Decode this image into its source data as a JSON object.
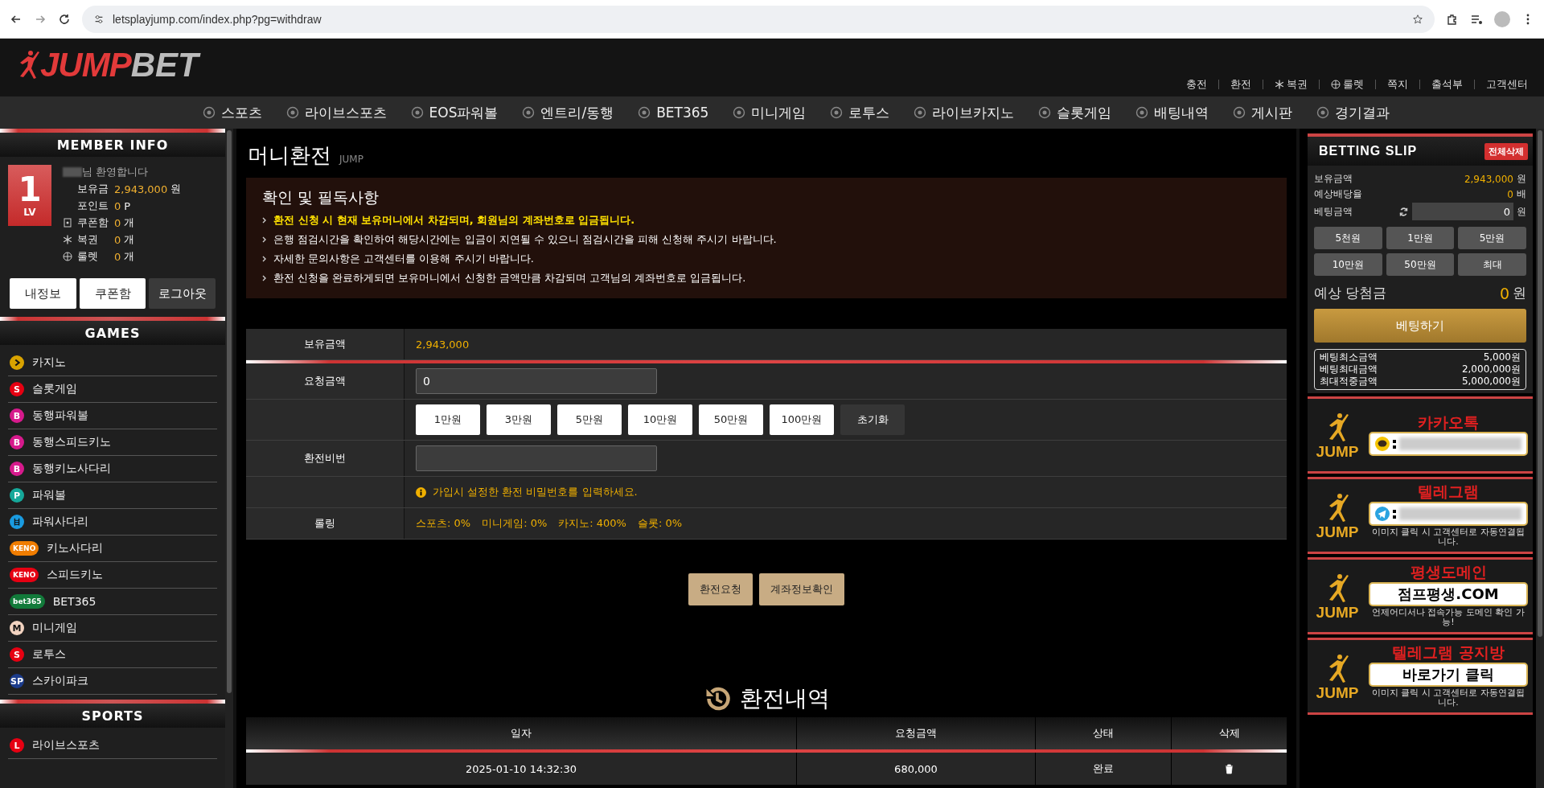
{
  "browser": {
    "url": "letsplayjump.com/index.php?pg=withdraw"
  },
  "header": {
    "logo": {
      "part_1": "JUMP",
      "part_2": "BET"
    },
    "top_links": [
      {
        "label": "충전",
        "kind": "text"
      },
      {
        "label": "환전",
        "kind": "text"
      },
      {
        "label": "복권",
        "kind": "lottery"
      },
      {
        "label": "룰렛",
        "kind": "roulette"
      },
      {
        "label": "쪽지",
        "kind": "text"
      },
      {
        "label": "출석부",
        "kind": "text"
      },
      {
        "label": "고객센터",
        "kind": "text"
      }
    ],
    "nav": [
      "스포츠",
      "라이브스포츠",
      "EOS파워볼",
      "엔트리/동행",
      "BET365",
      "미니게임",
      "로투스",
      "라이브카지노",
      "슬롯게임",
      "배팅내역",
      "게시판",
      "경기결과"
    ]
  },
  "sidebar": {
    "member": {
      "title": "MEMBER INFO",
      "level": "1",
      "level_label": "LV",
      "welcome": "님 환영합니다",
      "stats": [
        {
          "label": "보유금",
          "value": "2,943,000",
          "unit": "원",
          "kind": "plain"
        },
        {
          "label": "포인트",
          "value": "0",
          "unit": "P",
          "kind": "plain"
        },
        {
          "label": "쿠폰함",
          "value": "0",
          "unit": "개",
          "kind": "coupon"
        },
        {
          "label": "복권",
          "value": "0",
          "unit": "개",
          "kind": "lottery"
        },
        {
          "label": "룰렛",
          "value": "0",
          "unit": "개",
          "kind": "roulette"
        }
      ],
      "buttons": [
        {
          "label": "내정보",
          "kind": "light"
        },
        {
          "label": "쿠폰함",
          "kind": "light"
        },
        {
          "label": "로그아웃",
          "kind": "dark"
        }
      ]
    },
    "games": {
      "title": "GAMES",
      "items": [
        {
          "label": "카지노",
          "kind": "chevron",
          "color": "#d9a300"
        },
        {
          "label": "슬롯게임",
          "kind": "letter",
          "badge": "S",
          "color": "#e60012"
        },
        {
          "label": "동행파워볼",
          "kind": "letter",
          "badge": "B",
          "color": "#d61a8c"
        },
        {
          "label": "동행스피드키노",
          "kind": "letter",
          "badge": "B",
          "color": "#d61a8c"
        },
        {
          "label": "동행키노사다리",
          "kind": "letter",
          "badge": "B",
          "color": "#d61a8c"
        },
        {
          "label": "파워볼",
          "kind": "letter",
          "badge": "P",
          "color": "#16a89a"
        },
        {
          "label": "파워사다리",
          "kind": "ladder",
          "color": "#1a9be0"
        },
        {
          "label": "키노사다리",
          "kind": "letter",
          "badge": "KENO",
          "color": "#f07d00"
        },
        {
          "label": "스피드키노",
          "kind": "letter",
          "badge": "KENO",
          "color": "#e60012"
        },
        {
          "label": "BET365",
          "kind": "letter",
          "badge": "bet365",
          "color": "#127a3a"
        },
        {
          "label": "미니게임",
          "kind": "letter",
          "badge": "M",
          "color": "#f2d3c0"
        },
        {
          "label": "로투스",
          "kind": "letter",
          "badge": "S",
          "color": "#e60012"
        },
        {
          "label": "스카이파크",
          "kind": "letter",
          "badge": "SP",
          "color": "#1c3c8c"
        }
      ]
    },
    "sports": {
      "title": "SPORTS",
      "items": [
        {
          "label": "라이브스포츠",
          "kind": "letter",
          "badge": "L",
          "color": "#e60012"
        }
      ]
    }
  },
  "main": {
    "title": "머니환전",
    "subtitle": "JUMP",
    "notice": {
      "title": "확인 및 필독사항",
      "items": [
        {
          "text": "환전 신청 시 현재 보유머니에서 차감되며, 회원님의 계좌번호로 입금됩니다.",
          "highlight": true
        },
        {
          "text": "은행 점검시간을 확인하여 해당시간에는 입금이 지연될 수 있으니 점검시간을 피해 신청해 주시기 바랍니다.",
          "highlight": false
        },
        {
          "text": "자세한 문의사항은 고객센터를 이용해 주시기 바랍니다.",
          "highlight": false
        },
        {
          "text": "환전 신청을 완료하게되면 보유머니에서 신청한 금액만큼 차감되며 고객님의 계좌번호로 입금됩니다.",
          "highlight": false
        }
      ]
    },
    "form": [
      {
        "kind": "value",
        "label": "보유금액",
        "value": "2,943,000"
      },
      {
        "kind": "input",
        "label": "요청금액",
        "value": "0"
      },
      {
        "kind": "amounts",
        "buttons": [
          "1만원",
          "3만원",
          "5만원",
          "10만원",
          "50만원",
          "100만원"
        ],
        "reset": "초기화"
      },
      {
        "kind": "password",
        "label": "환전비번"
      },
      {
        "kind": "hint",
        "text": "가입시 설정한 환전 비밀번호를 입력하세요."
      },
      {
        "kind": "rolling",
        "label": "롤링",
        "items": [
          "스포츠: 0%",
          "미니게임: 0%",
          "카지노: 400%",
          "슬롯: 0%"
        ]
      }
    ],
    "actions": [
      "환전요청",
      "계좌정보확인"
    ],
    "history": {
      "title": "환전내역",
      "columns": [
        "일자",
        "요청금액",
        "상태",
        "삭제"
      ],
      "rows": [
        {
          "date": "2025-01-10 14:32:30",
          "amount": "680,000",
          "status": "완료"
        }
      ]
    }
  },
  "slip": {
    "title": "BETTING SLIP",
    "clear": "전체삭제",
    "rows": [
      {
        "label": "보유금액",
        "value": "2,943,000",
        "unit": "원"
      },
      {
        "label": "예상배당율",
        "value": "0",
        "unit": "배"
      }
    ],
    "bet": {
      "label": "베팅금액",
      "value": "0",
      "unit": "원"
    },
    "chips": [
      "5천원",
      "1만원",
      "5만원",
      "10만원",
      "50만원",
      "최대"
    ],
    "expected": {
      "label": "예상 당첨금",
      "value": "0",
      "unit": "원"
    },
    "submit": "베팅하기",
    "limits": [
      {
        "label": "베팅최소금액",
        "value": "5,000원"
      },
      {
        "label": "베팅최대금액",
        "value": "2,000,000원"
      },
      {
        "label": "최대적중금액",
        "value": "5,000,000원"
      }
    ],
    "banners": [
      {
        "kind": "kakao",
        "title": "카카오톡",
        "logo": "JUMP"
      },
      {
        "kind": "telegram",
        "title": "텔레그램",
        "logo": "JUMP",
        "caption": "이미지 클릭 시 고객센터로 자동연결됩니다."
      },
      {
        "kind": "text",
        "title": "평생도메인",
        "logo": "JUMP",
        "body": "점프평생.COM",
        "caption": "언제어디서나 접속가능 도메인 확인 가능!"
      },
      {
        "kind": "text",
        "title": "텔레그램 공지방",
        "logo": "JUMP",
        "body": "바로가기 클릭",
        "caption": "이미지 클릭 시 고객센터로 자동연결됩니다."
      }
    ]
  }
}
